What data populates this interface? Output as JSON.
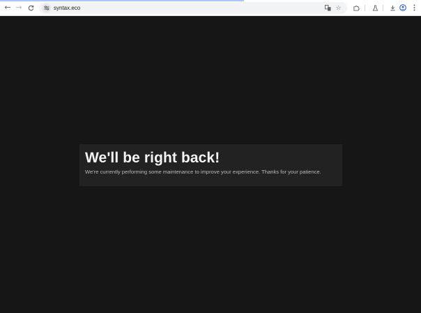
{
  "browser": {
    "url": "syntax.eco",
    "nav": {
      "back": "←",
      "forward": "→",
      "reload": "C"
    },
    "icons": {
      "site_info": "site-info-icon",
      "translate": "translate-icon",
      "bookmark": "star-icon",
      "extensions": "puzzle-icon",
      "labs": "flask-icon",
      "downloads": "download-icon",
      "profile": "profile-icon",
      "menu": "menu-icon"
    },
    "colors": {
      "toolbar": "#ffffff",
      "omnibox": "#f1f3f4",
      "load_bar": "#a8c7fa"
    }
  },
  "page": {
    "heading": "We'll be right back!",
    "message": "We're currently performing some maintenance to improve your experience. Thanks for your patience.",
    "colors": {
      "background": "#161616",
      "card": "#222222",
      "heading": "#f4f4f4",
      "message": "#b7b7b7"
    }
  }
}
